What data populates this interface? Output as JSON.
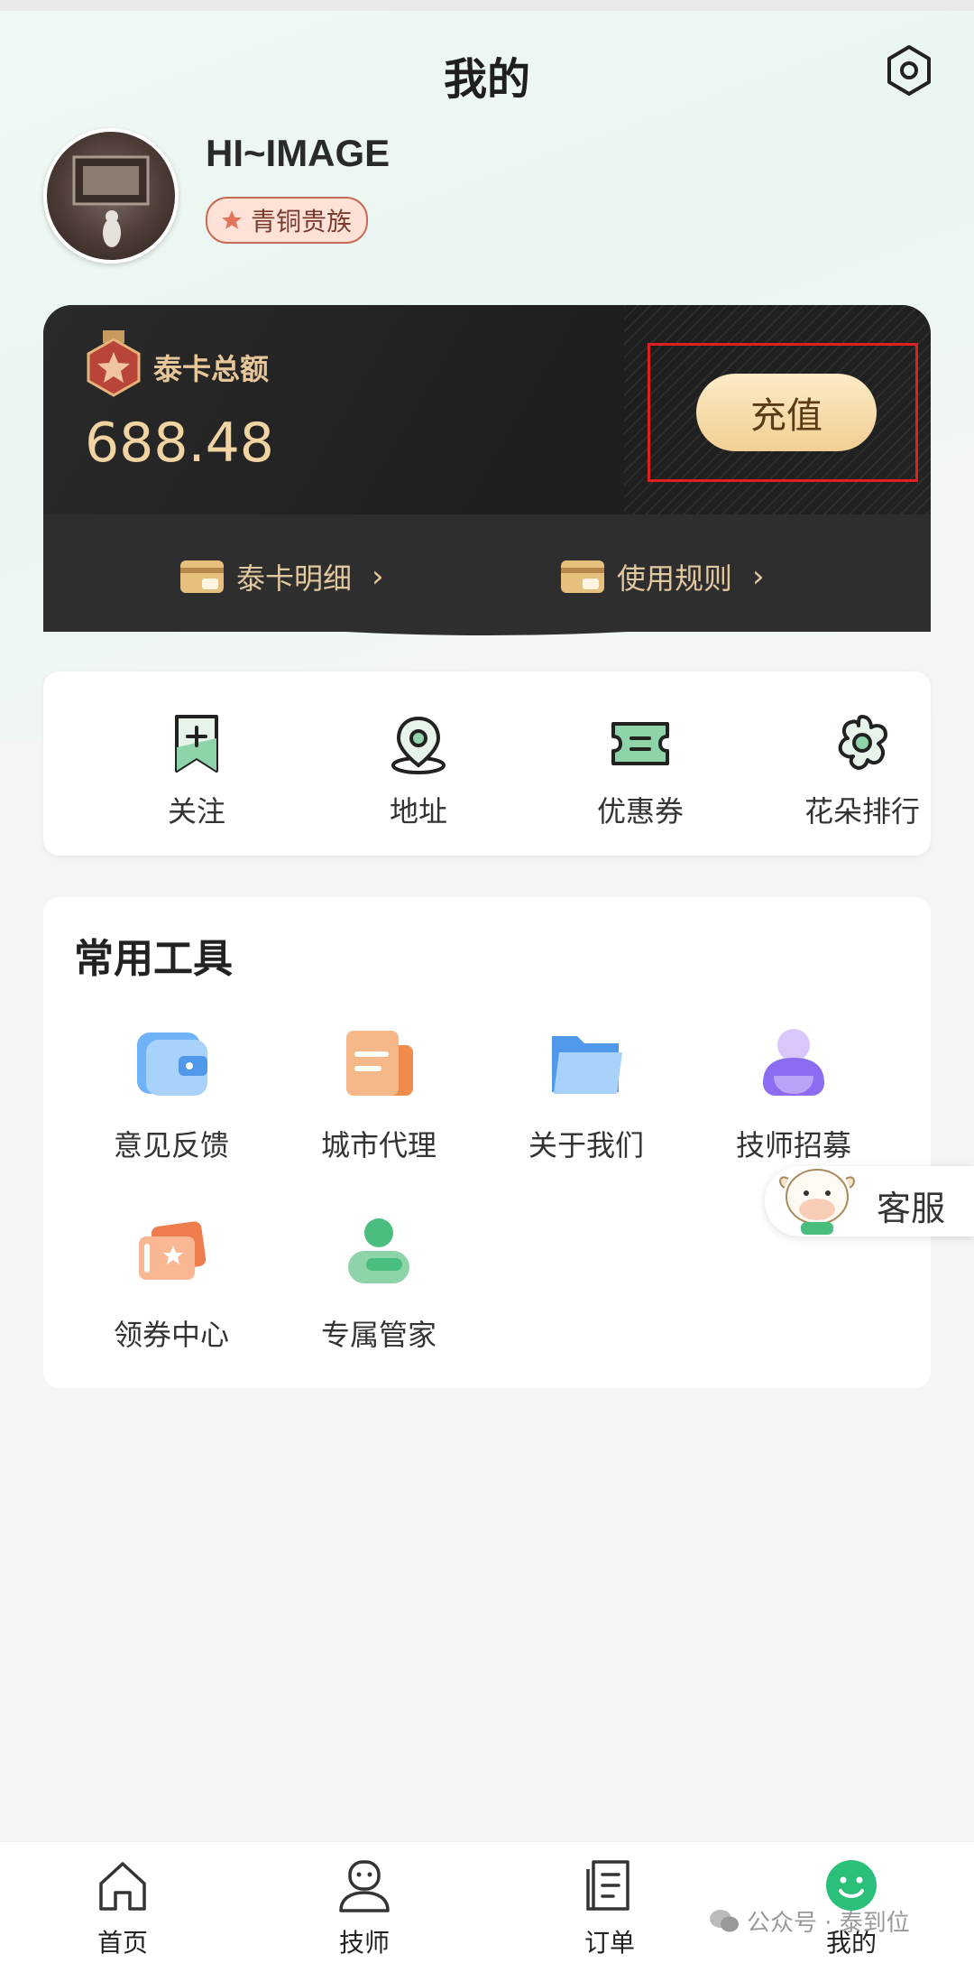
{
  "header": {
    "title": "我的"
  },
  "profile": {
    "username": "HI~IMAGE",
    "level_badge": "青铜贵族"
  },
  "balance_card": {
    "label": "泰卡总额",
    "amount": "688.48",
    "recharge_label": "充值",
    "links": [
      {
        "label": "泰卡明细",
        "icon": "wallet-icon"
      },
      {
        "label": "使用规则",
        "icon": "wallet-icon"
      }
    ]
  },
  "quick_actions": [
    {
      "label": "关注",
      "icon": "bookmark-plus-icon"
    },
    {
      "label": "地址",
      "icon": "location-pin-icon"
    },
    {
      "label": "优惠券",
      "icon": "ticket-icon"
    },
    {
      "label": "花朵排行",
      "icon": "flower-icon"
    }
  ],
  "tools": {
    "title": "常用工具",
    "items": [
      {
        "label": "意见反馈",
        "icon": "feedback-wallet-icon"
      },
      {
        "label": "城市代理",
        "icon": "city-agent-icon"
      },
      {
        "label": "关于我们",
        "icon": "folder-icon"
      },
      {
        "label": "技师招募",
        "icon": "recruit-person-icon"
      },
      {
        "label": "领券中心",
        "icon": "coupon-card-icon"
      },
      {
        "label": "专属管家",
        "icon": "butler-icon"
      }
    ]
  },
  "customer_service": {
    "label": "客服"
  },
  "tabbar": [
    {
      "label": "首页",
      "icon": "home-icon"
    },
    {
      "label": "技师",
      "icon": "technician-icon"
    },
    {
      "label": "订单",
      "icon": "order-icon"
    },
    {
      "label": "我的",
      "icon": "smile-icon",
      "active": true
    }
  ],
  "watermark": "公众号 · 泰到位",
  "colors": {
    "accent_green": "#2bc07a",
    "gold": "#f2d4a3",
    "highlight_red": "#e02020"
  }
}
